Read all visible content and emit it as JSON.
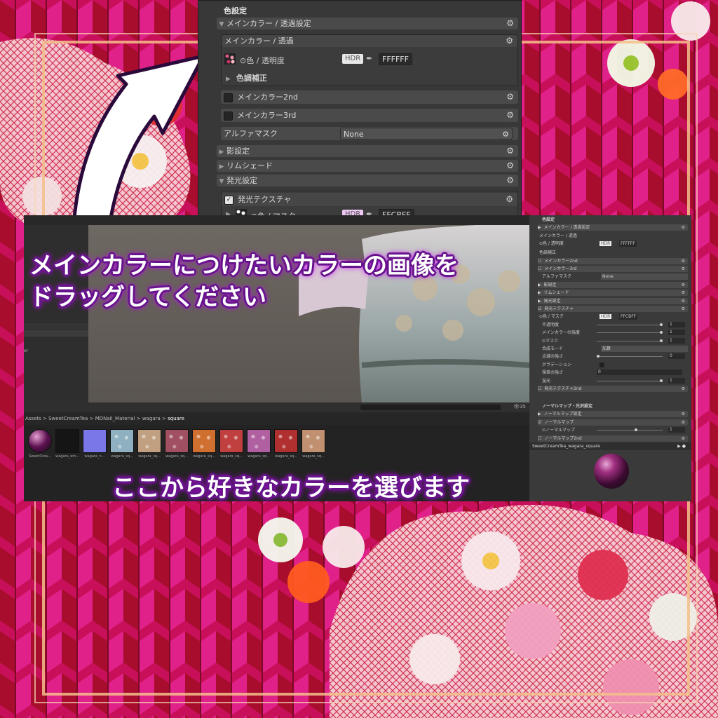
{
  "top_inspector": {
    "section_title": "色設定",
    "main_color_transparency_header": "メインカラー / 透過設定",
    "main_color_box_title": "メインカラー / 透過",
    "color_alpha_label": "⊙色 / 透明度",
    "hdr_label": "HDR",
    "main_color_hex": "FFFFFF",
    "color_correction_label": "色調補正",
    "main_color_2nd": "メインカラー2nd",
    "main_color_3rd": "メインカラー3rd",
    "alpha_mask_label": "アルファマスク",
    "alpha_mask_value": "None",
    "shadow_settings": "影設定",
    "rim_shade": "リムシェード",
    "emission_settings": "発光設定",
    "emission_texture": "発光テクスチャ",
    "color_mask_label": "⊙色 / マスク",
    "emission_hex": "FFCBFF"
  },
  "editor": {
    "breadcrumb": [
      "Assets",
      "SweetCreamTea",
      "MDNail_Material",
      "wagara",
      "square"
    ],
    "asset_count": "35",
    "assets": [
      {
        "name": "SweetCrea...",
        "color": "#3a1a3a"
      },
      {
        "name": "wagara_em...",
        "color": "#151515"
      },
      {
        "name": "wagara_n...",
        "color": "#7a78e8"
      },
      {
        "name": "wagara_sq...",
        "color": "#8fb0c0"
      },
      {
        "name": "wagara_sq...",
        "color": "#c0a080"
      },
      {
        "name": "wagara_sq...",
        "color": "#a05060"
      },
      {
        "name": "wagara_sq...",
        "color": "#d07030"
      },
      {
        "name": "wagara_sq...",
        "color": "#c04040"
      },
      {
        "name": "wagara_sq...",
        "color": "#b060a0"
      },
      {
        "name": "wagara_sq...",
        "color": "#b03030"
      },
      {
        "name": "wagara_sq...",
        "color": "#c09070"
      }
    ],
    "left_pane_text": "er"
  },
  "right_inspector": {
    "rows": [
      {
        "label": "色設定",
        "type": "title"
      },
      {
        "label": "メインカラー / 透過設定",
        "type": "header"
      },
      {
        "label": "メインカラー / 透過",
        "type": "sub"
      },
      {
        "label": "⊙色 / 透明度",
        "type": "color",
        "hex": "FFFFFF",
        "hdr": "HDR"
      },
      {
        "label": "色調補正",
        "type": "plain"
      },
      {
        "label": "メインカラー2nd",
        "type": "check"
      },
      {
        "label": "メインカラー3rd",
        "type": "check"
      },
      {
        "label": "アルファマスク",
        "type": "drop",
        "value": "None"
      },
      {
        "label": "影設定",
        "type": "header"
      },
      {
        "label": "リムシェード",
        "type": "header"
      },
      {
        "label": "発光設定",
        "type": "header"
      },
      {
        "label": "発光テクスチャ",
        "type": "checkon"
      },
      {
        "label": "⊙色 / マスク",
        "type": "color",
        "hex": "FFCBFF",
        "hdr": "HDR"
      },
      {
        "label": "不透明度",
        "type": "slider",
        "value": "1",
        "level": 1.0
      },
      {
        "label": "メインカラーの強度",
        "type": "slider",
        "value": "1",
        "level": 1.0
      },
      {
        "label": "⊙マスク",
        "type": "slider",
        "value": "1",
        "level": 1.0
      },
      {
        "label": "合成モード",
        "type": "drop",
        "value": "加算"
      },
      {
        "label": "点滅の強さ",
        "type": "slider",
        "value": "0",
        "level": 0.0
      },
      {
        "label": "グラデーション",
        "type": "check2"
      },
      {
        "label": "視差の強さ",
        "type": "num",
        "value": "0"
      },
      {
        "label": "蛍光",
        "type": "slider",
        "value": "1",
        "level": 1.0
      },
      {
        "label": "発光テクスチャ2nd",
        "type": "check"
      },
      {
        "label": "ノーマルマップ・光沢設定",
        "type": "title"
      },
      {
        "label": "ノーマルマップ設定",
        "type": "header"
      },
      {
        "label": "ノーマルマップ",
        "type": "checkon"
      },
      {
        "label": "⊙ノーマルマップ",
        "type": "slider",
        "value": "1",
        "level": 0.6
      },
      {
        "label": "ノーマルマップ2nd",
        "type": "check"
      }
    ],
    "preview_title": "SweetCreamTea_wagara_square"
  },
  "callouts": {
    "drag_line1": "メインカラーにつけたいカラーの画像を",
    "drag_line2": "ドラッグしてください",
    "choose": "ここから好きなカラーを選びます"
  }
}
